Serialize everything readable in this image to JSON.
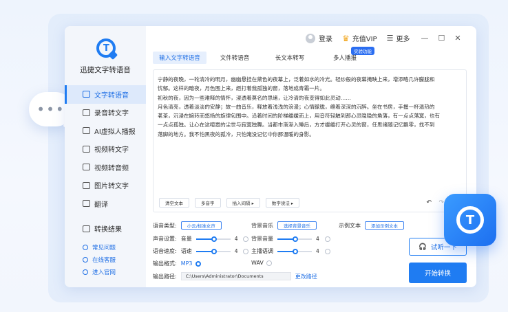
{
  "app": {
    "name": "迅捷文字转语音"
  },
  "topbar": {
    "login": "登录",
    "vip": "充值VIP",
    "more": "更多",
    "badge": "实验功能"
  },
  "tabs": [
    "输入文字转语音",
    "文件转语音",
    "长文本转写",
    "多人播报"
  ],
  "sidebar": {
    "items": [
      "文字转语音",
      "录音转文字",
      "AI虚拟人播报",
      "视频转文字",
      "视频转音频",
      "图片转文字",
      "翻译"
    ],
    "convert": "转换结果",
    "help": [
      "常见问题",
      "在线客服",
      "进入官网"
    ]
  },
  "editor": {
    "text": [
      "宁静的夜晚，一轮清冷的明月，幽幽悬挂在黛色的夜幕上，泛着如水的冷光。轻纱般的夜幕掩映上来，增添略几许朦胧和",
      "忧郁。这样的暗夜，月色围上来，趔打着我孤独的窗，落地成青霜一片。",
      "初秋的夜，因为一些难释的情怀，浸透着莫名的思绪，让冷清的夜变得如此灵动……",
      "月色清亮，透着淡淡的安静；故一曲音乐，释放着浅浅的浪漫；心情朦胧，缠着深深的沉醉。坐在书房，手握一杯温热的",
      "茗茶，沉浸在婉转而悠扬的旋律包围中。沿着时间的阶梯缓缓而上，用音符轻触到那心灵隐隐的角落，有一点点落寞，也有",
      "一点点孤独。让心在这喧嚣的尘世与寂寞独舞。当都市渐渐入睡后，方才缓缓打开心灵的窗，任思绪随记忆飘零，找不到",
      "落脚的地方。我不怕黑夜的孤冷，只怕淹没记忆中你那温暖的身影。"
    ],
    "tools": [
      "清空文本",
      "多音字",
      "插入间隔 ▸",
      "数字读法 ▸"
    ]
  },
  "settings": {
    "voice_type_label": "语音类型:",
    "voice_type_value": "小云/标准女声",
    "bgm_label": "背景音乐",
    "bgm_value": "选择背景音乐",
    "sample_label": "示例文本",
    "sample_value": "添加示例文本",
    "sound_label": "声音设置:",
    "volume_label": "音量",
    "volume_value": "4",
    "bg_volume_label": "背景音量",
    "bg_volume_value": "4",
    "speed_label": "语音速度:",
    "rate_label": "语速",
    "rate_value": "4",
    "tone_label": "主播语调",
    "tone_value": "4",
    "format_label": "输出格式:",
    "format_mp3": "MP3",
    "format_wav": "WAV",
    "path_label": "输出路径:",
    "path_value": "C:\\Users\\Administrator\\Documents",
    "path_change": "更改路径",
    "slider_fractions": {
      "volume": 0.5,
      "bg_volume": 0.5,
      "rate": 0.5,
      "tone": 0.5
    }
  },
  "actions": {
    "try": "试听一下",
    "start": "开始转换"
  },
  "colors": {
    "accent": "#1f7cf2"
  }
}
